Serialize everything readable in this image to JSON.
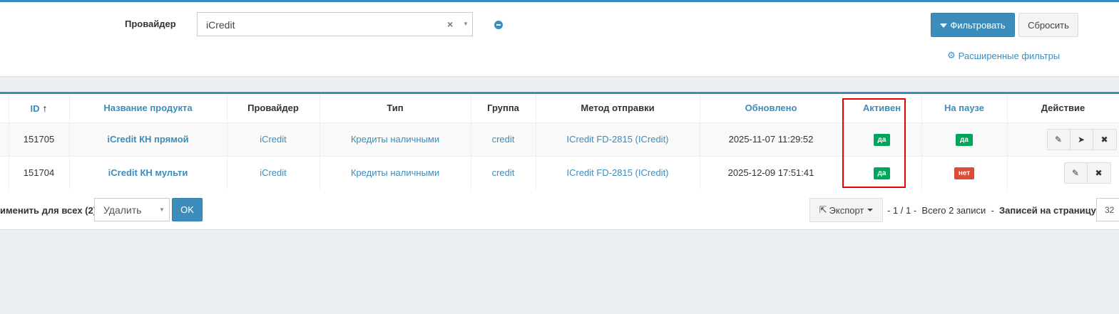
{
  "filter": {
    "provider_label": "Провайдер",
    "provider_value": "iCredit",
    "clear_symbol": "×",
    "dropdown_symbol": "▼",
    "filter_button": "Фильтровать",
    "reset_button": "Сбросить",
    "advanced_filters": "Расширенные фильтры"
  },
  "table": {
    "columns": [
      "ID",
      "Название продукта",
      "Провайдер",
      "Тип",
      "Группа",
      "Метод отправки",
      "Обновлено",
      "Активен",
      "На паузе",
      "Действие"
    ],
    "sort_indicator": "🡑",
    "rows": [
      {
        "id": "151705",
        "name": "iCredit КН прямой",
        "provider": "iCredit",
        "type": "Кредиты наличными",
        "group": "credit",
        "method": "ICredit FD-2815 (ICredit)",
        "updated": "2025-11-07 11:29:52",
        "active": "да",
        "paused": "да"
      },
      {
        "id": "151704",
        "name": "iCredit КН мульти",
        "provider": "iCredit",
        "type": "Кредиты наличными",
        "group": "credit",
        "method": "ICredit FD-2815 (ICredit)",
        "updated": "2025-12-09 17:51:41",
        "active": "да",
        "paused": "нет"
      }
    ]
  },
  "footer": {
    "apply_label": "именить для всех (2)",
    "bulk_action_value": "Удалить",
    "dropdown_symbol": "▼",
    "ok_button": "OK",
    "export_button": "Экспорт",
    "pager_pages": "- 1 / 1 -",
    "pager_total": "Всего 2 записи",
    "pager_sep": "-",
    "per_page_label": "Записей на страницу",
    "per_page_value": "32"
  },
  "colors": {
    "accent": "#3c8dbc",
    "success": "#00a65a",
    "danger": "#dd4b39",
    "highlight": "#ee0000"
  }
}
